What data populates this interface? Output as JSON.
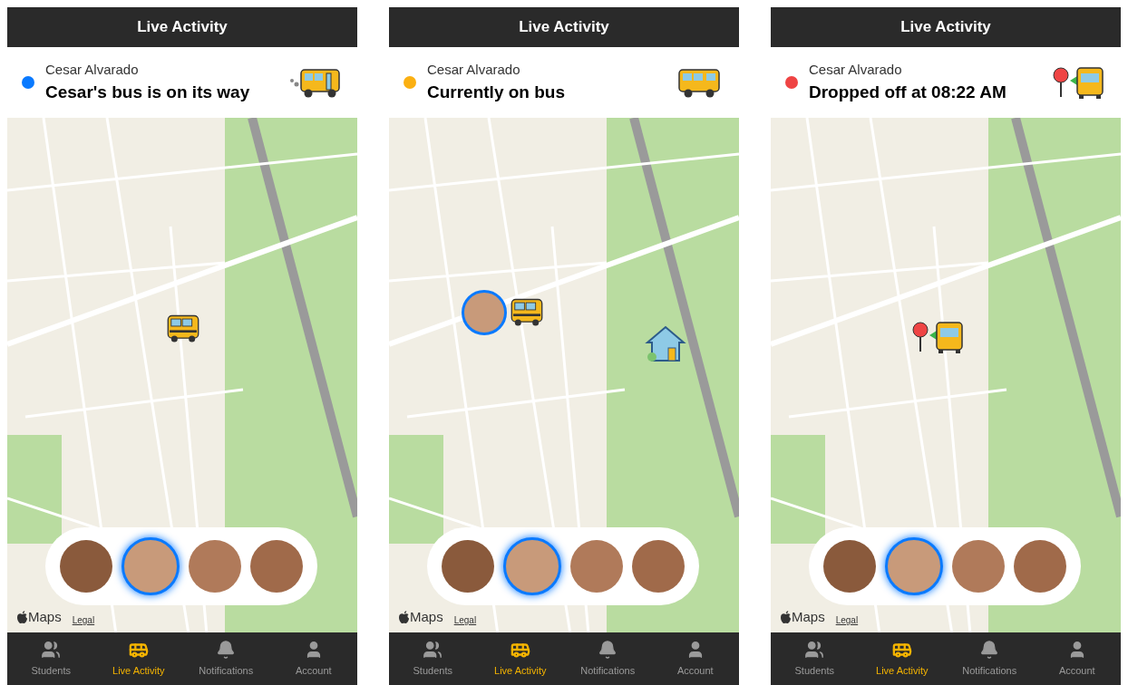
{
  "phones": [
    {
      "title": "Live Activity",
      "student_name": "Cesar Alvarado",
      "status": {
        "kind": "bus-moving",
        "text": "Cesar's bus is on its way",
        "color": "#0a7aff"
      },
      "markers": [
        {
          "kind": "bus"
        }
      ],
      "avatars": [
        {
          "selected": false
        },
        {
          "selected": true
        },
        {
          "selected": false
        },
        {
          "selected": false
        }
      ],
      "attribution": {
        "maps": "Maps",
        "legal": "Legal"
      },
      "tabs": [
        {
          "label": "Students",
          "kind": "students",
          "selected": false
        },
        {
          "label": "Live Activity",
          "kind": "bus",
          "selected": true
        },
        {
          "label": "Notifications",
          "kind": "bell",
          "selected": false
        },
        {
          "label": "Account",
          "kind": "person",
          "selected": false
        }
      ]
    },
    {
      "title": "Live Activity",
      "student_name": "Cesar Alvarado",
      "status": {
        "kind": "bus",
        "text": "Currently on bus",
        "color": "#fbb012"
      },
      "markers": [
        {
          "kind": "child-bus"
        },
        {
          "kind": "school"
        }
      ],
      "avatars": [
        {
          "selected": false
        },
        {
          "selected": true
        },
        {
          "selected": false
        },
        {
          "selected": false
        }
      ],
      "attribution": {
        "maps": "Maps",
        "legal": "Legal"
      },
      "tabs": [
        {
          "label": "Students",
          "kind": "students",
          "selected": false
        },
        {
          "label": "Live Activity",
          "kind": "bus",
          "selected": true
        },
        {
          "label": "Notifications",
          "kind": "bell",
          "selected": false
        },
        {
          "label": "Account",
          "kind": "person",
          "selected": false
        }
      ]
    },
    {
      "title": "Live Activity",
      "student_name": "Cesar Alvarado",
      "status": {
        "kind": "dropoff",
        "text": "Dropped off at 08:22 AM",
        "color": "#ef4444"
      },
      "markers": [
        {
          "kind": "dropoff"
        }
      ],
      "avatars": [
        {
          "selected": false
        },
        {
          "selected": true
        },
        {
          "selected": false
        },
        {
          "selected": false
        }
      ],
      "attribution": {
        "maps": "Maps",
        "legal": "Legal"
      },
      "tabs": [
        {
          "label": "Students",
          "kind": "students",
          "selected": false
        },
        {
          "label": "Live Activity",
          "kind": "bus",
          "selected": true
        },
        {
          "label": "Notifications",
          "kind": "bell",
          "selected": false
        },
        {
          "label": "Account",
          "kind": "person",
          "selected": false
        }
      ]
    }
  ]
}
